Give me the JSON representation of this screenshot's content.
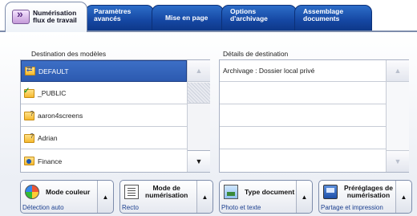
{
  "tabs": [
    {
      "label_line1": "Numérisation",
      "label_line2": "flux de travail",
      "active": true
    },
    {
      "label_line1": "Paramètres",
      "label_line2": "avancés",
      "active": false
    },
    {
      "label_line1": "Mise en page",
      "label_line2": "",
      "active": false
    },
    {
      "label_line1": "Options",
      "label_line2": "d'archivage",
      "active": false
    },
    {
      "label_line1": "Assemblage",
      "label_line2": "documents",
      "active": false
    }
  ],
  "templates": {
    "label": "Destination des modèles",
    "items": [
      {
        "label": "DEFAULT",
        "icon": "folder-sync-icon",
        "selected": true
      },
      {
        "label": "_PUBLIC",
        "icon": "folder-check-icon",
        "selected": false
      },
      {
        "label": "aaron4screens",
        "icon": "folder-question-icon",
        "selected": false
      },
      {
        "label": "Adrian",
        "icon": "folder-question-icon",
        "selected": false
      },
      {
        "label": "Finance",
        "icon": "folder-globe-icon",
        "selected": false
      }
    ]
  },
  "details": {
    "label": "Détails de destination",
    "items": [
      "Archivage : Dossier local privé",
      "",
      "",
      "",
      ""
    ]
  },
  "features": [
    {
      "label": "Mode couleur",
      "value": "Détection auto",
      "icon": "color-wheel-icon"
    },
    {
      "label": "Mode de numérisation",
      "label_line1": "Mode de",
      "label_line2": "numérisation",
      "value": "Recto",
      "icon": "document-icon"
    },
    {
      "label": "Type document",
      "value": "Photo et texte",
      "icon": "photo-icon"
    },
    {
      "label": "Préréglages de numérisation",
      "label_line1": "Préréglages de",
      "label_line2": "numérisation",
      "value": "Partage et impression",
      "icon": "preset-icon"
    }
  ],
  "colors": {
    "accent": "#1547a3",
    "selection": "#2c5ab0",
    "value_text": "#1b3f8f"
  }
}
